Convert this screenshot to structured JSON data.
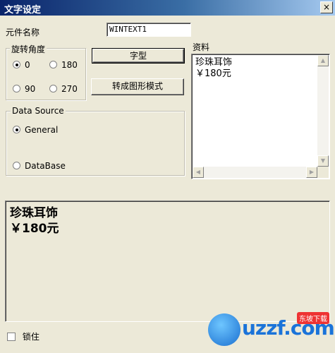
{
  "window": {
    "title": "文字设定",
    "close_glyph": "×"
  },
  "element_name": {
    "label": "元件名称",
    "value": "WINTEXT1"
  },
  "rotation": {
    "label": "旋转角度",
    "options": [
      {
        "label": "0",
        "selected": true
      },
      {
        "label": "180",
        "selected": false
      },
      {
        "label": "90",
        "selected": false
      },
      {
        "label": "270",
        "selected": false
      }
    ]
  },
  "buttons": {
    "font": "字型",
    "convert": "转成图形模式"
  },
  "data_source": {
    "label": "Data Source",
    "options": [
      {
        "label": "General",
        "selected": true
      },
      {
        "label": "DataBase",
        "selected": false
      }
    ]
  },
  "data": {
    "label": "资料",
    "line1": "珍珠耳饰",
    "line2": "￥180元"
  },
  "preview": {
    "line1": "珍珠耳饰",
    "line2": "￥180元"
  },
  "lock": {
    "label": "锁住",
    "checked": false
  },
  "watermark": {
    "text": "uzzf.com",
    "tag": "东坡下载"
  },
  "icons": {
    "close": "close-icon",
    "scroll_up": "arrow-up-icon",
    "scroll_down": "arrow-down-icon",
    "scroll_left": "arrow-left-icon",
    "scroll_right": "arrow-right-icon"
  }
}
